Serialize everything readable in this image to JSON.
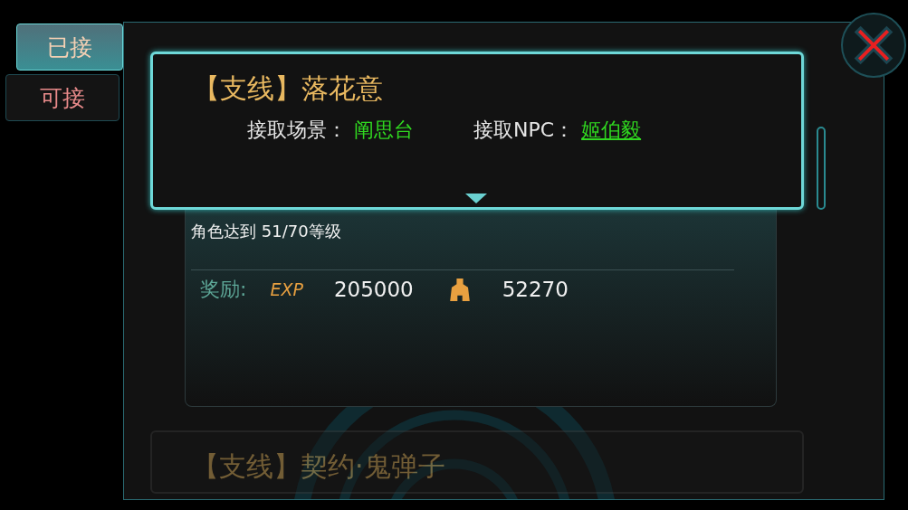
{
  "tabs": [
    {
      "label": "已接",
      "selected": true
    },
    {
      "label": "可接",
      "selected": false
    }
  ],
  "quests": [
    {
      "title": "【支线】落花意",
      "selected": true,
      "expanded": true,
      "scene_label": "接取场景：",
      "scene": "阐思台",
      "npc_label": "接取NPC：",
      "npc": "姬伯毅",
      "requirement": "角色达到 51/70等级",
      "reward_label": "奖励:",
      "rewards": [
        {
          "kind": "exp",
          "label": "EXP",
          "amount": "205000"
        },
        {
          "kind": "currency",
          "amount": "52270"
        }
      ]
    },
    {
      "title": "【支线】契约·鬼弹子",
      "selected": false,
      "expanded": false
    }
  ]
}
